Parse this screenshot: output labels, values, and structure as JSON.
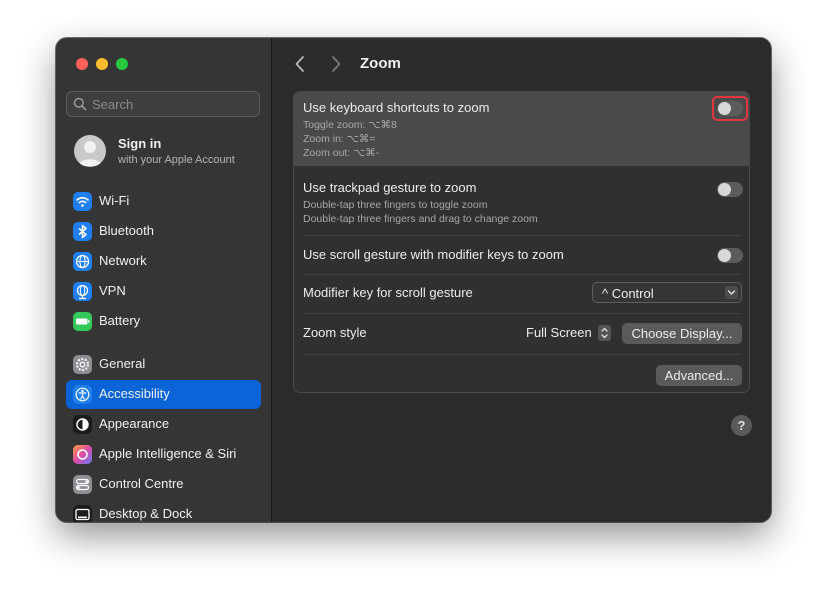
{
  "sidebar": {
    "search_placeholder": "Search",
    "account": {
      "title": "Sign in",
      "subtitle": "with your Apple Account"
    },
    "items": [
      {
        "label": "Wi-Fi",
        "icon": "wifi-icon",
        "color": "#1f7ff0"
      },
      {
        "label": "Bluetooth",
        "icon": "bluetooth-icon",
        "color": "#1f7ff0"
      },
      {
        "label": "Network",
        "icon": "globe-icon",
        "color": "#1f7ff0"
      },
      {
        "label": "VPN",
        "icon": "vpn-globe-icon",
        "color": "#1f7ff0"
      },
      {
        "label": "Battery",
        "icon": "battery-icon",
        "color": "#34c759"
      },
      {
        "label": "General",
        "icon": "gear-icon",
        "color": "#8e8e93"
      },
      {
        "label": "Accessibility",
        "icon": "accessibility-icon",
        "color": "#1f7ff0",
        "selected": true
      },
      {
        "label": "Appearance",
        "icon": "appearance-icon",
        "color": "#1c1c1e"
      },
      {
        "label": "Apple Intelligence & Siri",
        "icon": "siri-icon",
        "color": "#e05bb0"
      },
      {
        "label": "Control Centre",
        "icon": "control-centre-icon",
        "color": "#8e8e93"
      },
      {
        "label": "Desktop & Dock",
        "icon": "dock-icon",
        "color": "#1c1c1e"
      }
    ]
  },
  "header": {
    "title": "Zoom"
  },
  "settings": {
    "keyboard": {
      "title": "Use keyboard shortcuts to zoom",
      "lines": [
        "Toggle zoom: ⌥⌘8",
        "Zoom in: ⌥⌘=",
        "Zoom out: ⌥⌘-"
      ],
      "enabled": false
    },
    "trackpad": {
      "title": "Use trackpad gesture to zoom",
      "lines": [
        "Double-tap three fingers to toggle zoom",
        "Double-tap three fingers and drag to change zoom"
      ],
      "enabled": false
    },
    "scroll": {
      "title": "Use scroll gesture with modifier keys to zoom",
      "enabled": false
    },
    "modifier": {
      "title": "Modifier key for scroll gesture",
      "value": "^ Control"
    },
    "zoom_style": {
      "title": "Zoom style",
      "value": "Full Screen",
      "button": "Choose Display..."
    },
    "advanced_button": "Advanced..."
  },
  "help_label": "?",
  "colors": {
    "accent": "#0a64d8",
    "focus_ring": "#e0383e"
  }
}
